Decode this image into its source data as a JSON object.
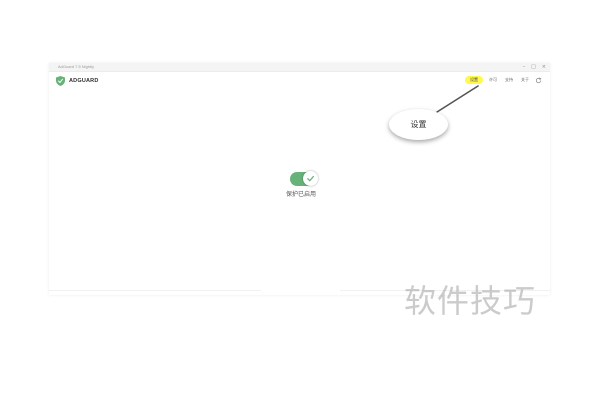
{
  "window": {
    "title": "AdGuard 7.5 Nightly",
    "controls": {
      "minimize": "–",
      "maximize": "□",
      "close": "×"
    }
  },
  "header": {
    "brand_name": "ADGUARD",
    "nav": [
      {
        "label": "设置",
        "active": true
      },
      {
        "label": "许可"
      },
      {
        "label": "支持"
      },
      {
        "label": "关于"
      }
    ],
    "refresh_icon": "refresh-icon"
  },
  "main": {
    "protection_toggle": {
      "on": true
    },
    "status_text": "保护已启用"
  },
  "annotation": {
    "callout_text": "设置"
  },
  "watermark": {
    "text": "软件技巧"
  },
  "colors": {
    "accent": "#67b279",
    "highlight": "#fff84d"
  }
}
